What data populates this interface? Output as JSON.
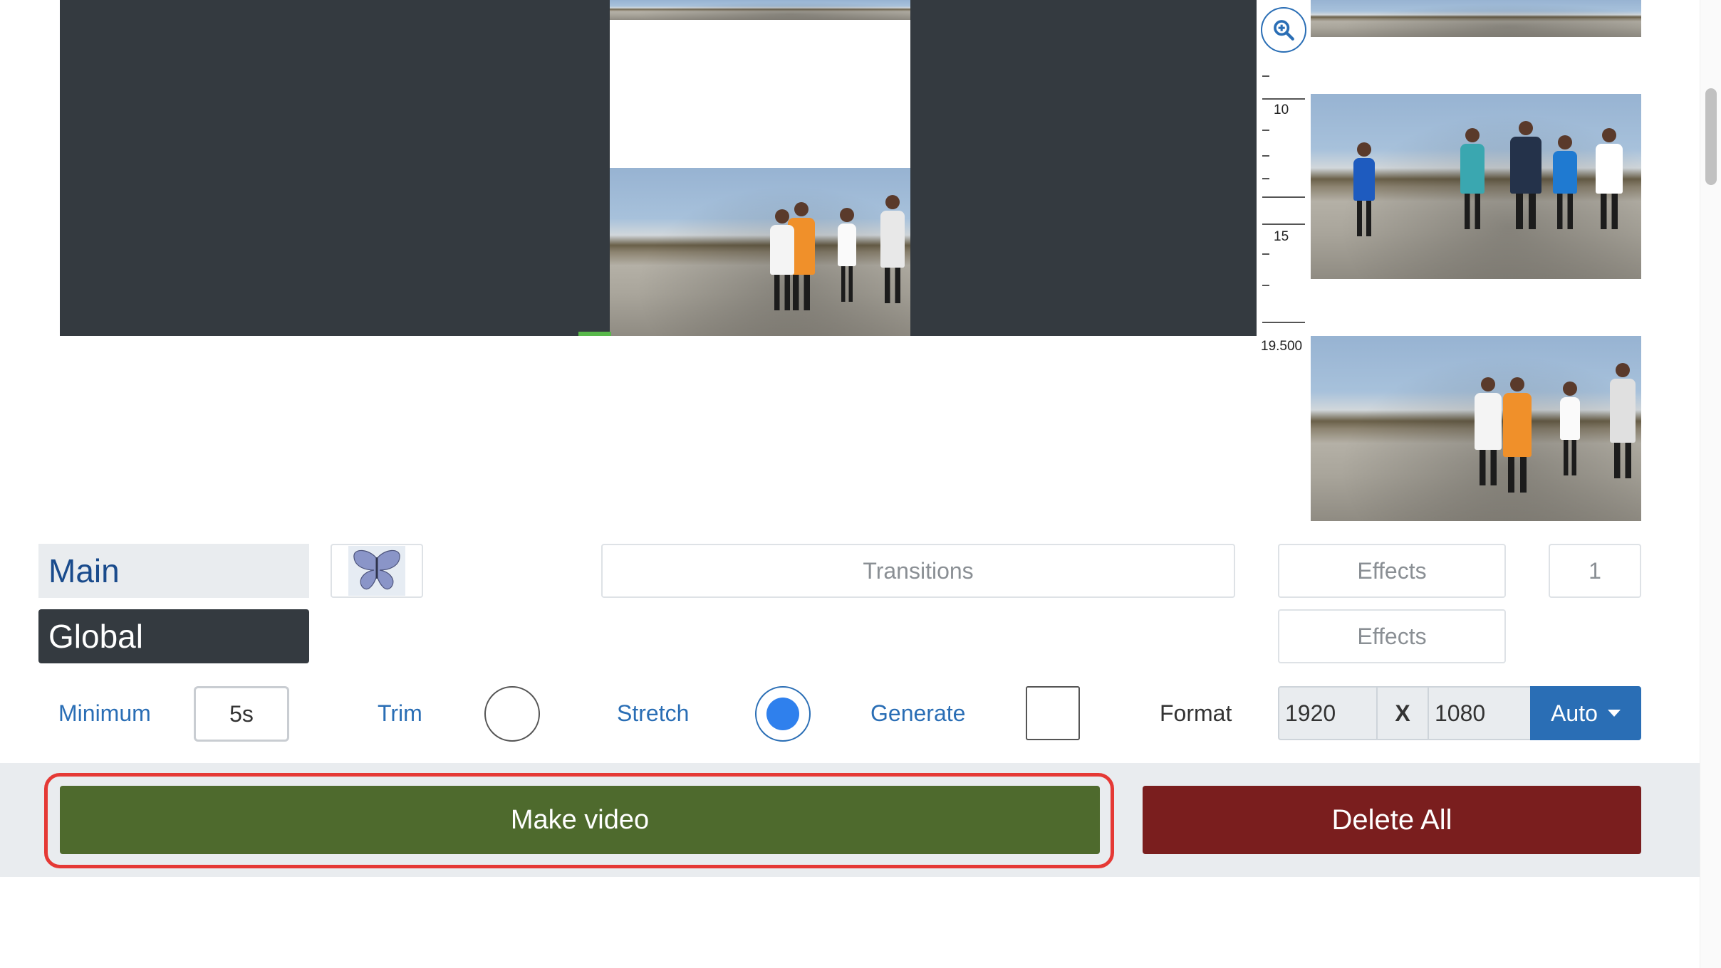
{
  "ruler": {
    "label_10": "10",
    "label_15": "15",
    "label_end": "19.500"
  },
  "tabs": {
    "main": "Main",
    "global": "Global"
  },
  "controls": {
    "transitions": "Transitions",
    "effects_main": "Effects",
    "effects_global": "Effects",
    "count": "1"
  },
  "options": {
    "minimum_label": "Minimum",
    "minimum_value": "5s",
    "trim_label": "Trim",
    "trim_selected": false,
    "stretch_label": "Stretch",
    "stretch_selected": true,
    "generate_label": "Generate",
    "generate_checked": false,
    "format_label": "Format",
    "width": "1920",
    "x_label": "X",
    "height": "1080",
    "format_mode": "Auto"
  },
  "actions": {
    "make_video": "Make video",
    "delete_all": "Delete All"
  },
  "colors": {
    "make_video": "#4e6a2d",
    "delete_all": "#7a1e1e",
    "highlight": "#e53935",
    "accent": "#2a6eb5"
  },
  "icons": [
    "zoom-in-icon",
    "butterfly-icon",
    "chevron-down-icon"
  ]
}
